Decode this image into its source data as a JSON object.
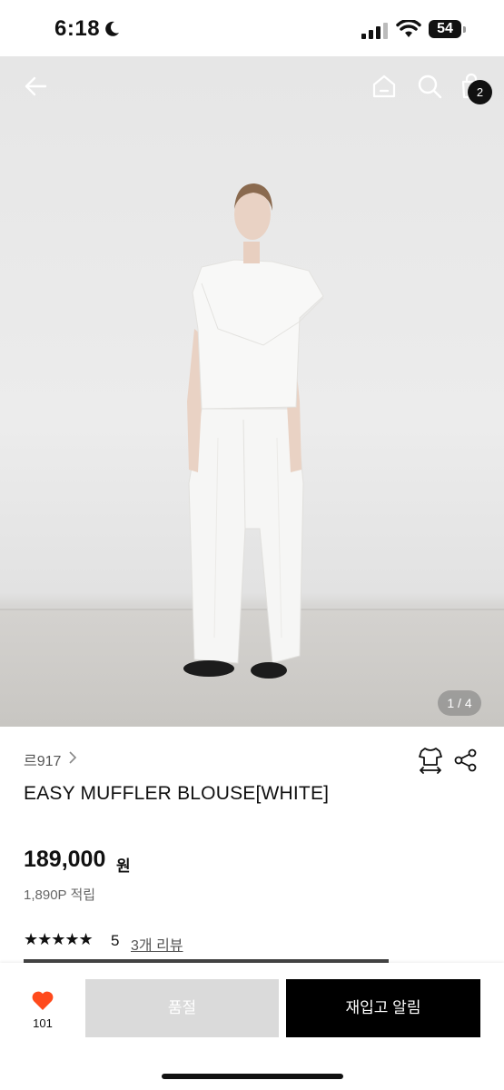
{
  "status_bar": {
    "time": "6:18",
    "battery": "54"
  },
  "header": {
    "cart_count": "2"
  },
  "gallery": {
    "page_indicator": "1 / 4"
  },
  "product": {
    "brand": "르917",
    "title": "EASY MUFFLER BLOUSE[WHITE]",
    "price": "189,000",
    "currency": "원",
    "points": "1,890P 적립",
    "stars": "★★★★★",
    "rating": "5",
    "review_link": "3개 리뷰"
  },
  "bottom_bar": {
    "like_count": "101",
    "soldout_label": "품절",
    "restock_label": "재입고 알림"
  },
  "colors": {
    "accent_heart": "#ff4a1c",
    "primary_button": "#000000",
    "disabled_button": "#dadada"
  }
}
